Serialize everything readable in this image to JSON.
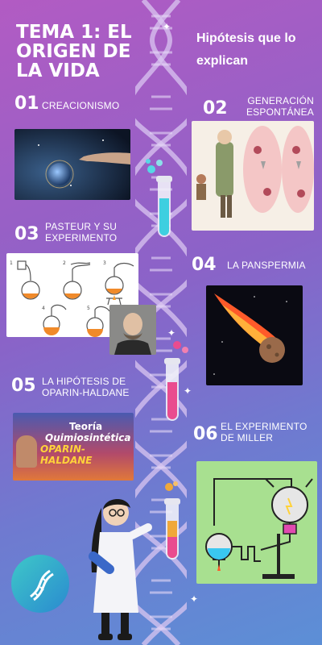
{
  "header": {
    "title": "TEMA 1: EL ORIGEN DE LA VIDA",
    "subtitle": "Hipótesis que lo explican"
  },
  "items": [
    {
      "num": "01",
      "label": "CREACIONISMO"
    },
    {
      "num": "02",
      "label": "GENERACIÓN ESPONTÁNEA"
    },
    {
      "num": "03",
      "label": "PASTEUR Y SU EXPERIMENTO"
    },
    {
      "num": "04",
      "label": "LA PANSPERMIA"
    },
    {
      "num": "05",
      "label": "LA HIPÓTESIS DE OPARIN-HALDANE"
    },
    {
      "num": "06",
      "label": "EL EXPERIMENTO DE MILLER"
    }
  ],
  "banner": {
    "line1": "Teoría",
    "line2": "Quimiosintética",
    "line3": "OPARIN-HALDANE"
  },
  "colors": {
    "accent_pink": "#e94c8f",
    "accent_cyan": "#56d7e6",
    "bg_top": "#b25bc3",
    "bg_bottom": "#5c8fd6"
  }
}
